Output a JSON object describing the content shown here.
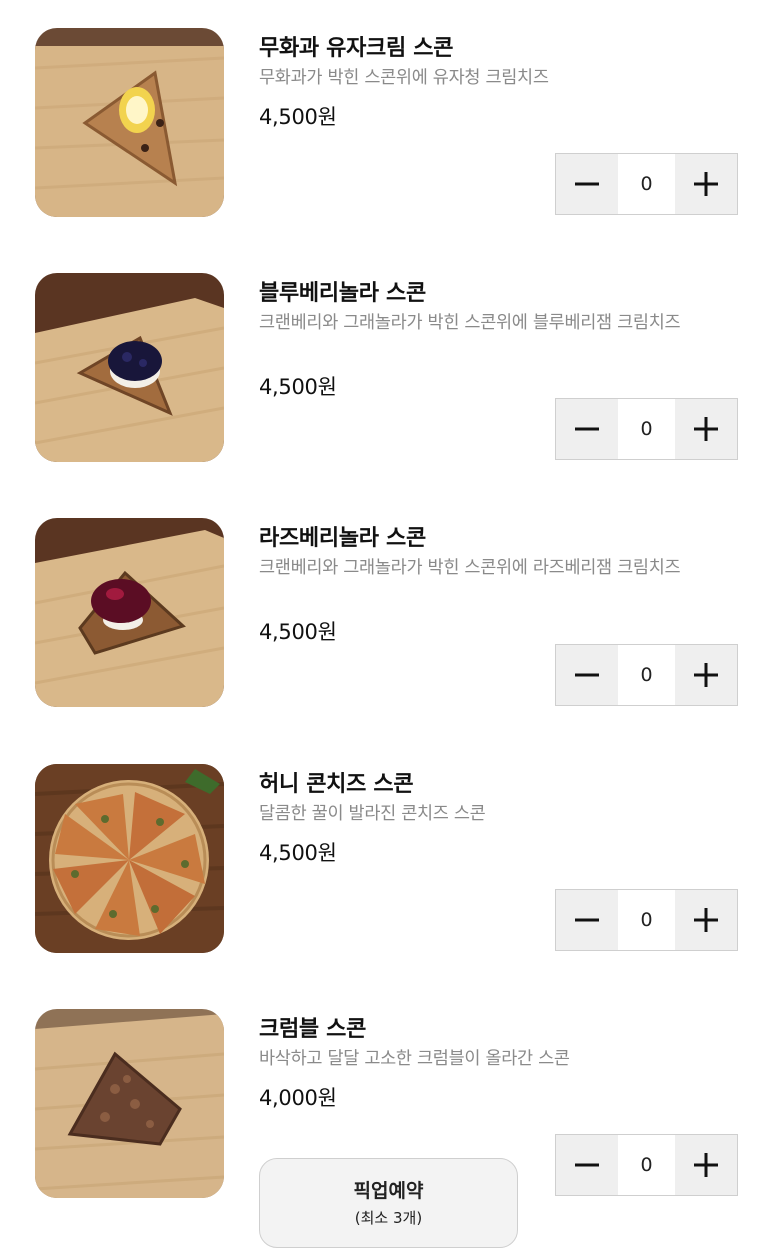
{
  "currency_suffix": "원",
  "menu": {
    "items": [
      {
        "name": "무화과 유자크림 스콘",
        "description": "무화과가 박힌 스콘위에 유자청 크림치즈",
        "price": "4,500원",
        "quantity": "0",
        "image": "fig-yuja-scone-photo"
      },
      {
        "name": "블루베리놀라 스콘",
        "description": "크랜베리와 그래놀라가 박힌 스콘위에 블루베리잼 크림치즈",
        "price": "4,500원",
        "quantity": "0",
        "image": "blueberry-scone-photo"
      },
      {
        "name": "라즈베리놀라 스콘",
        "description": "크랜베리와 그래놀라가 박힌 스콘위에 라즈베리잼 크림치즈",
        "price": "4,500원",
        "quantity": "0",
        "image": "raspberry-scone-photo"
      },
      {
        "name": "허니 콘치즈 스콘",
        "description": "달콤한 꿀이 발라진 콘치즈 스콘",
        "price": "4,500원",
        "quantity": "0",
        "image": "honey-corn-cheese-scone-photo"
      },
      {
        "name": "크럼블 스콘",
        "description": "바삭하고 달달 고소한 크럼블이 올라간 스콘",
        "price": "4,000원",
        "quantity": "0",
        "image": "crumble-scone-photo"
      }
    ]
  },
  "stepper": {
    "minus_icon": "minus-icon",
    "plus_icon": "plus-icon"
  },
  "pickup": {
    "label": "픽업예약",
    "min_note": "(최소 3개)"
  },
  "colors": {
    "stepper_button_bg": "#efefef",
    "description_text": "#8a8a8a",
    "border": "#cfcfcf"
  }
}
